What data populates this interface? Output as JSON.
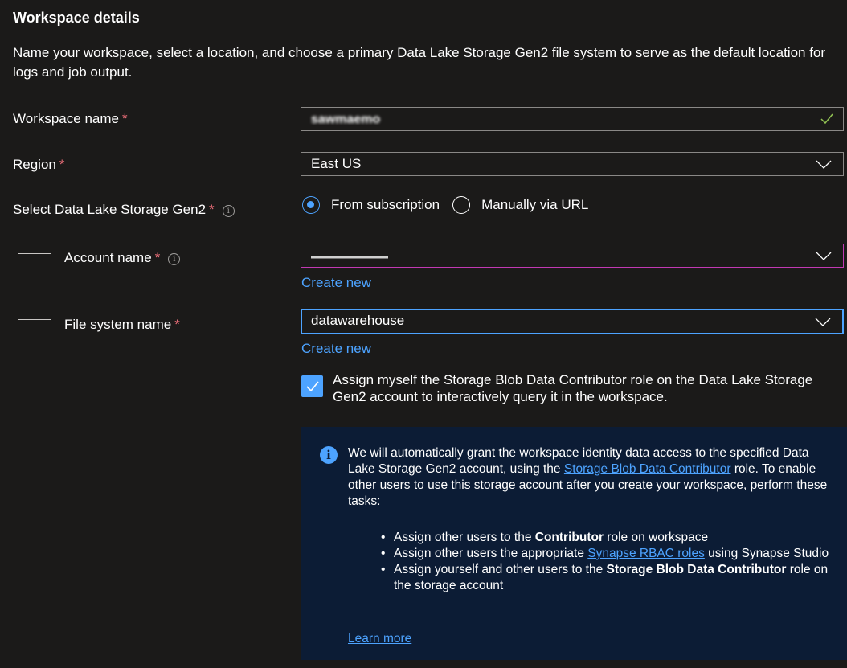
{
  "section": {
    "title": "Workspace details",
    "description": "Name your workspace, select a location, and choose a primary Data Lake Storage Gen2 file system to serve as the default location for logs and job output."
  },
  "workspace_name": {
    "label": "Workspace name",
    "required_mark": "*",
    "value": "sawmaemo"
  },
  "region": {
    "label": "Region",
    "required_mark": "*",
    "value": "East US"
  },
  "data_lake": {
    "label": "Select Data Lake Storage Gen2",
    "required_mark": "*",
    "options": [
      "From subscription",
      "Manually via URL"
    ],
    "selected": "From subscription"
  },
  "account_name": {
    "label": "Account name",
    "required_mark": "*",
    "value": "",
    "create_new": "Create new"
  },
  "file_system_name": {
    "label": "File system name",
    "required_mark": "*",
    "value": "datawarehouse",
    "create_new": "Create new"
  },
  "assign_role": {
    "checked": true,
    "label": "Assign myself the Storage Blob Data Contributor role on the Data Lake Storage Gen2 account to interactively query it in the workspace."
  },
  "info": {
    "text_before_link": "We will automatically grant the workspace identity data access to the specified Data Lake Storage Gen2 account, using the ",
    "link": "Storage Blob Data Contributor",
    "text_after_link": " role. To enable other users to use this storage account after you create your workspace, perform these tasks:",
    "bullets": {
      "b1_pre": "Assign other users to the ",
      "b1_bold": "Contributor",
      "b1_post": " role on workspace",
      "b2_pre": "Assign other users the appropriate ",
      "b2_link": "Synapse RBAC roles",
      "b2_post": " using Synapse Studio",
      "b3_pre": "Assign yourself and other users to the ",
      "b3_bold": "Storage Blob Data Contributor",
      "b3_post": " role on the storage account"
    },
    "learn_more": "Learn more"
  },
  "icons": {
    "info": "info-circle-icon",
    "chevron": "chevron-down-icon",
    "check": "checkmark-icon"
  },
  "colors": {
    "background": "#1b1a19",
    "accent": "#4da3ff",
    "required": "#f1707b",
    "valid": "#92c353",
    "error_border": "#c239b3",
    "infobar": "#0c1c35"
  }
}
